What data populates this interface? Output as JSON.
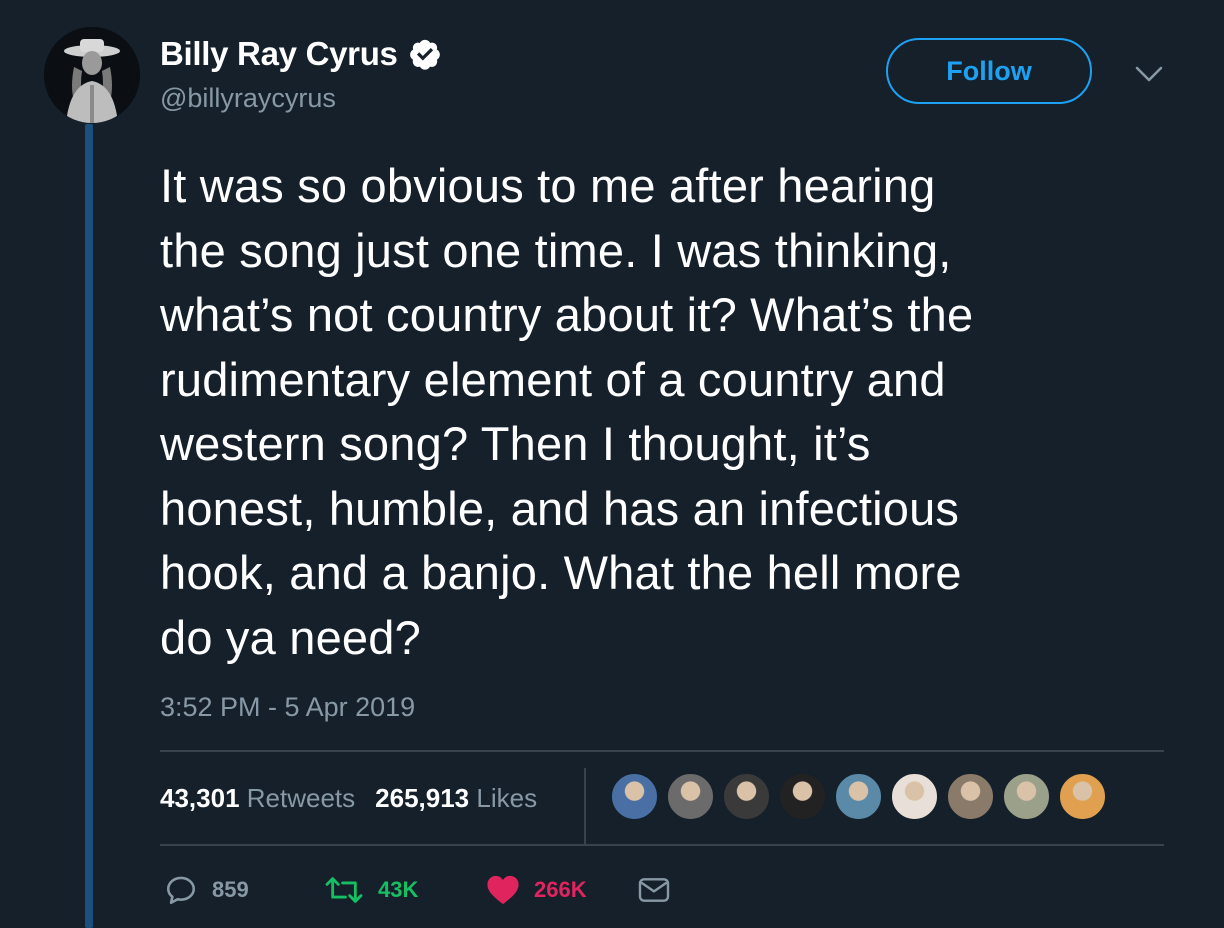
{
  "user": {
    "display_name": "Billy Ray Cyrus",
    "handle": "@billyraycyrus",
    "verified": true,
    "avatar": "avatar-icon"
  },
  "follow_label": "Follow",
  "tweet": {
    "text": "It was so obvious to me after hearing\nthe song just one time. I was thinking,\nwhat’s not country about it? What’s the\nrudimentary element of a country and\nwestern song? Then I thought, it’s\nhonest, humble, and has an infectious\nhook,  and a banjo.  What the hell more\ndo ya need?",
    "timestamp": "3:52 PM - 5 Apr 2019"
  },
  "stats": {
    "retweets_count": "43,301",
    "retweets_label": "Retweets",
    "likes_count": "265,913",
    "likes_label": "Likes"
  },
  "likers": [
    {
      "icon": "liker-avatar-1-icon",
      "color": "#4a6fa5"
    },
    {
      "icon": "liker-avatar-2-icon",
      "color": "#6b6b6b"
    },
    {
      "icon": "liker-avatar-3-icon",
      "color": "#3a3a3a"
    },
    {
      "icon": "liker-avatar-4-icon",
      "color": "#222222"
    },
    {
      "icon": "liker-avatar-5-icon",
      "color": "#5b8aa8"
    },
    {
      "icon": "liker-avatar-6-icon",
      "color": "#e8e0d8"
    },
    {
      "icon": "liker-avatar-7-icon",
      "color": "#8a7a6a"
    },
    {
      "icon": "liker-avatar-8-icon",
      "color": "#9aa08a"
    },
    {
      "icon": "liker-avatar-9-icon",
      "color": "#e0a050"
    }
  ],
  "actions": {
    "reply_count": "859",
    "retweet_count": "43K",
    "like_count": "266K"
  },
  "colors": {
    "background": "#15202b",
    "accent": "#1da1f2",
    "muted": "#8899a6",
    "retweet": "#17bf63",
    "like": "#e0245e",
    "divider": "#38444d",
    "thread_line": "#1d4f7e"
  }
}
